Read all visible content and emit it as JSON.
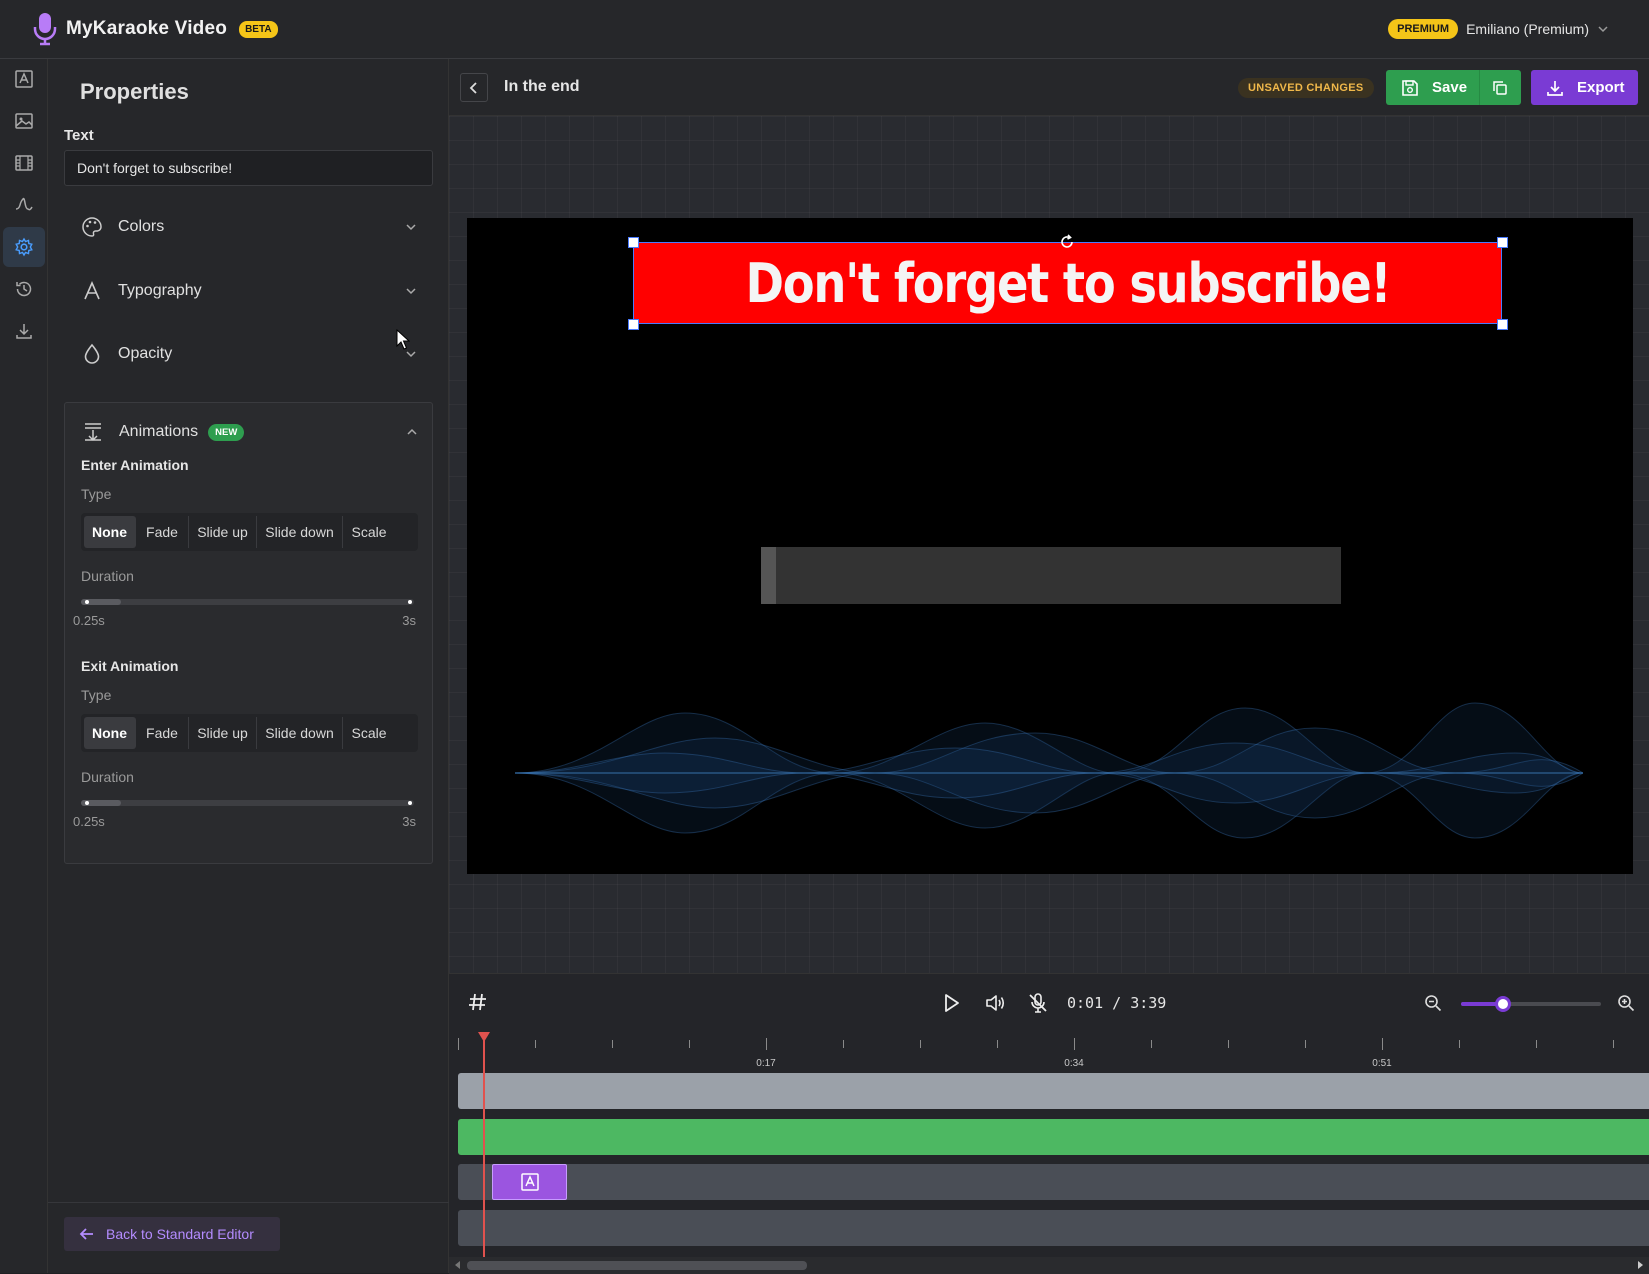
{
  "app": {
    "name": "MyKaraoke Video",
    "badge": "BETA",
    "plan_badge": "PREMIUM",
    "user": "Emiliano (Premium)"
  },
  "sidebar_icons": [
    "text-icon",
    "image-icon",
    "film-icon",
    "waveform-icon",
    "settings-icon",
    "history-icon",
    "download-icon"
  ],
  "properties": {
    "title": "Properties",
    "text_label": "Text",
    "text_value": "Don't forget to subscribe!",
    "sections": {
      "colors": "Colors",
      "typography": "Typography",
      "opacity": "Opacity",
      "animations": "Animations",
      "animations_badge": "NEW"
    },
    "enter": {
      "title": "Enter Animation",
      "type_label": "Type",
      "options": [
        "None",
        "Fade",
        "Slide up",
        "Slide down",
        "Scale"
      ],
      "selected": "None",
      "duration_label": "Duration",
      "min": "0.25s",
      "max": "3s",
      "duration_fraction": 0.12
    },
    "exit": {
      "title": "Exit Animation",
      "type_label": "Type",
      "options": [
        "None",
        "Fade",
        "Slide up",
        "Slide down",
        "Scale"
      ],
      "selected": "None",
      "duration_label": "Duration",
      "min": "0.25s",
      "max": "3s",
      "duration_fraction": 0.12
    },
    "back_button": "Back to Standard Editor"
  },
  "editor": {
    "project_title": "In the end",
    "unsaved": "UNSAVED CHANGES",
    "save": "Save",
    "export": "Export"
  },
  "canvas": {
    "banner_text": "Don't forget to subscribe!",
    "banner_color": "#ff0000",
    "lyric_progress_fraction": 0.025
  },
  "timeline": {
    "time": "0:01 / 3:39",
    "zoom_fraction": 0.3,
    "ruler_labels": [
      "0:17",
      "0:34",
      "0:51"
    ],
    "tracks": [
      {
        "name": "background",
        "color": "#9ba1a9"
      },
      {
        "name": "audio",
        "color": "#4db862"
      },
      {
        "name": "text",
        "color": "#4a4e56"
      },
      {
        "name": "empty",
        "color": "#4a4e56"
      }
    ]
  },
  "colors": {
    "accent_purple": "#7a3bd4",
    "save_green": "#2e9e4f",
    "premium_yellow": "#f5c518"
  }
}
